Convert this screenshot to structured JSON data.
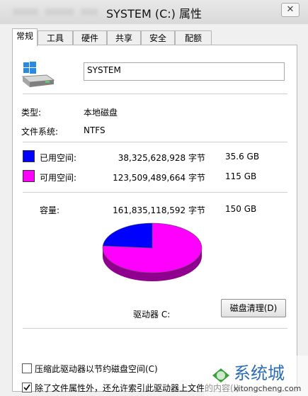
{
  "window": {
    "title": "SYSTEM (C:) 属性",
    "close": "✕"
  },
  "tabs": [
    {
      "label": "常规"
    },
    {
      "label": "工具"
    },
    {
      "label": "硬件"
    },
    {
      "label": "共享"
    },
    {
      "label": "安全"
    },
    {
      "label": "配额"
    }
  ],
  "drive": {
    "name": "SYSTEM"
  },
  "info": {
    "type_label": "类型:",
    "type_value": "本地磁盘",
    "fs_label": "文件系统:",
    "fs_value": "NTFS"
  },
  "space": {
    "used_label": "已用空间:",
    "used_bytes": "38,325,628,928 字节",
    "used_gb": "35.6 GB",
    "used_color": "#0000ff",
    "free_label": "可用空间:",
    "free_bytes": "123,509,489,664 字节",
    "free_gb": "115 GB",
    "free_color": "#ff00ff",
    "cap_label": "容量:",
    "cap_bytes": "161,835,118,592 字节",
    "cap_gb": "150 GB",
    "used_fraction": 0.2368
  },
  "drive_label": "驱动器 C:",
  "cleanup_button": "磁盘清理(D)",
  "options": {
    "compress": "压缩此驱动器以节约磁盘空间(C)",
    "index": "除了文件属性外，还允许索引此驱动器上文件的内容(I)"
  },
  "watermark": {
    "text": "系统城",
    "url": "xitongcheng.com"
  }
}
